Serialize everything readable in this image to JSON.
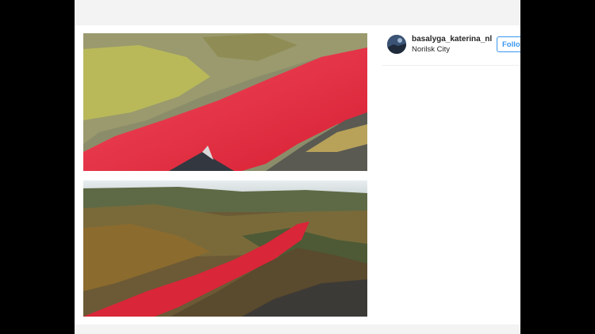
{
  "post": {
    "username": "basalyga_katerina_nl",
    "location": "Norilsk City",
    "follow_label": "Follo"
  },
  "images": [
    {
      "icon": "red-river-aerial-photo"
    },
    {
      "icon": "red-river-valley-photo"
    }
  ],
  "colors": {
    "river_red": "#e8283a",
    "follow_blue": "#3897f0",
    "page_background": "#000000"
  }
}
